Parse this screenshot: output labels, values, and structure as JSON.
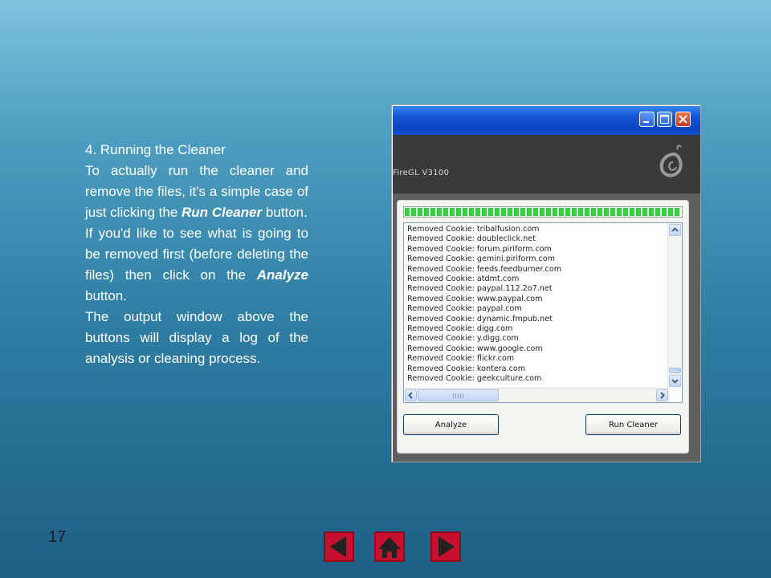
{
  "slide": {
    "heading": "4. Running the Cleaner",
    "para1_a": "To actually run the cleaner and remove the files, it's a simple case of just clicking the ",
    "para1_emph": "Run Cleaner",
    "para1_b": " button.",
    "para2_a": "If you'd like to see what is going to be removed first (before deleting the files) then click on the ",
    "para2_emph": "Analyze",
    "para2_b": " button.",
    "para3": "The output window above the buttons will display a log of the analysis or cleaning process.",
    "page_number": "17"
  },
  "window": {
    "gpu_label": "FireGL V3100",
    "progress_fraction": 1.0,
    "log_lines": [
      "Removed Cookie: tribalfusion.com",
      "Removed Cookie: doubleclick.net",
      "Removed Cookie: forum.piriform.com",
      "Removed Cookie: gemini.piriform.com",
      "Removed Cookie: feeds.feedburner.com",
      "Removed Cookie: atdmt.com",
      "Removed Cookie: paypal.112.2o7.net",
      "Removed Cookie: www.paypal.com",
      "Removed Cookie: paypal.com",
      "Removed Cookie: dynamic.fmpub.net",
      "Removed Cookie: digg.com",
      "Removed Cookie: y.digg.com",
      "Removed Cookie: www.google.com",
      "Removed Cookie: flickr.com",
      "Removed Cookie: kontera.com",
      "Removed Cookie: geekculture.com"
    ],
    "analyze_label": "Analyze",
    "run_cleaner_label": "Run Cleaner"
  },
  "colors": {
    "nav_button": "#c8102e",
    "progress": "#2fbf36",
    "titlebar": "#1456d6"
  }
}
